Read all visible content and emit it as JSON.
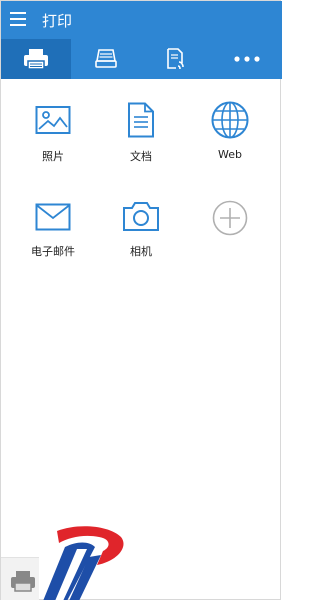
{
  "header": {
    "title": "打印",
    "menu_icon": "hamburger-menu-icon"
  },
  "tabs": [
    {
      "icon": "printer-icon",
      "active": true
    },
    {
      "icon": "scanner-icon",
      "active": false
    },
    {
      "icon": "document-phone-icon",
      "active": false
    },
    {
      "icon": "more-dots-icon",
      "active": false
    }
  ],
  "sources": [
    {
      "label": "照片",
      "icon": "photo-icon"
    },
    {
      "label": "文档",
      "icon": "document-icon"
    },
    {
      "label": "Web",
      "icon": "globe-icon"
    },
    {
      "label": "电子邮件",
      "icon": "email-icon"
    },
    {
      "label": "相机",
      "icon": "camera-icon"
    },
    {
      "label": "",
      "icon": "add-circle-icon"
    }
  ],
  "colors": {
    "primary": "#2e86d3",
    "tab_active": "#1f6fb8",
    "icon_blue": "#2e86d3",
    "icon_gray": "#b0b0b0",
    "logo_red": "#e0252b",
    "logo_blue": "#1e4ea8"
  }
}
